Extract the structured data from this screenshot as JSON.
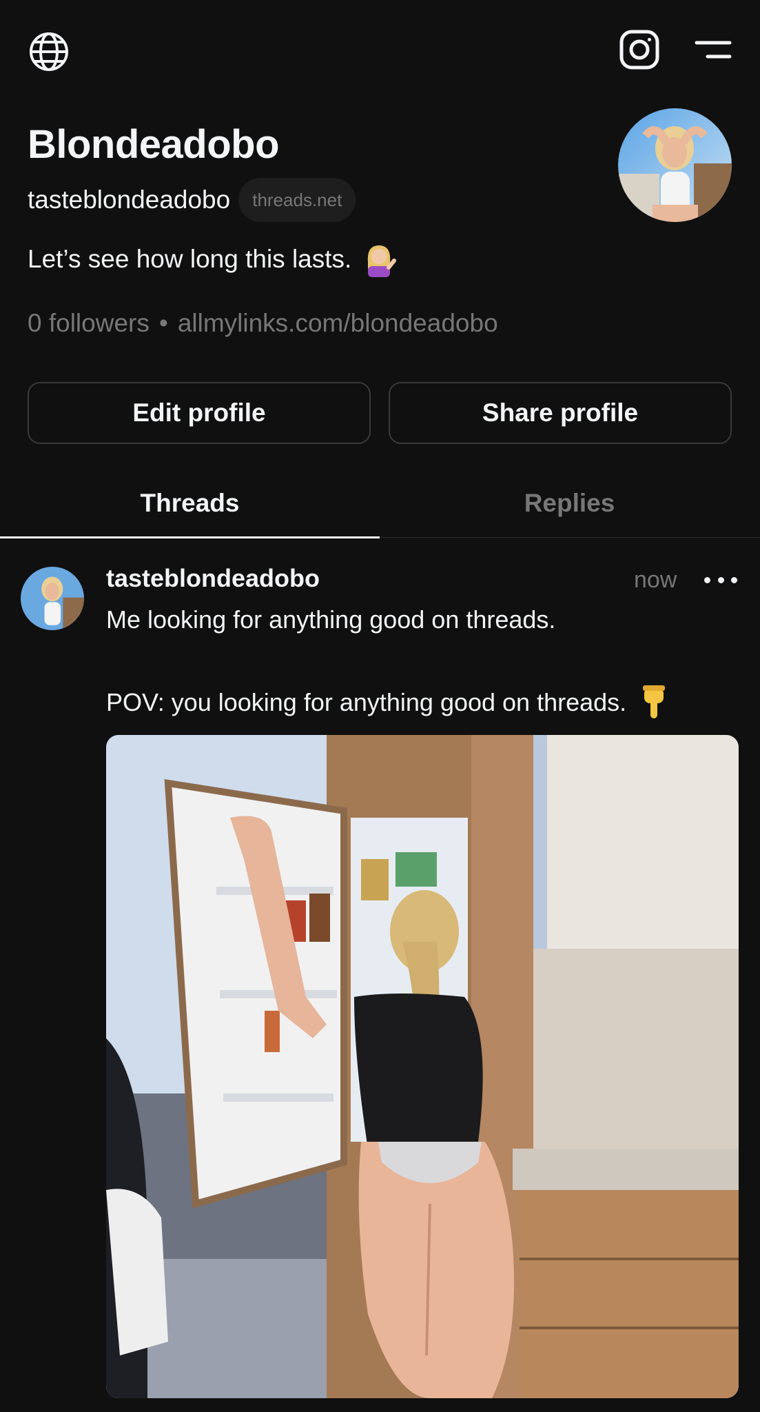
{
  "topbar": {
    "left_icon": "globe-icon",
    "right_icons": [
      "instagram-icon",
      "menu-icon"
    ]
  },
  "profile": {
    "display_name": "Blondeadobo",
    "username": "tasteblondeadobo",
    "domain_chip": "threads.net",
    "bio": "Let’s see how long this lasts.",
    "followers": "0 followers",
    "separator": "•",
    "link": "allmylinks.com/blondeadobo"
  },
  "actions": {
    "edit_label": "Edit profile",
    "share_label": "Share profile"
  },
  "tabs": [
    {
      "label": "Threads",
      "active": true
    },
    {
      "label": "Replies",
      "active": false
    }
  ],
  "post": {
    "username": "tasteblondeadobo",
    "time": "now",
    "line1": "Me looking for anything good on threads.",
    "line2": "POV: you looking for anything good on threads.",
    "image_icon": "photo-kitchen-fridge"
  },
  "colors": {
    "background": "#101010",
    "text_primary": "#f3f5f7",
    "text_secondary": "#777777",
    "border": "#3a3a3a"
  }
}
